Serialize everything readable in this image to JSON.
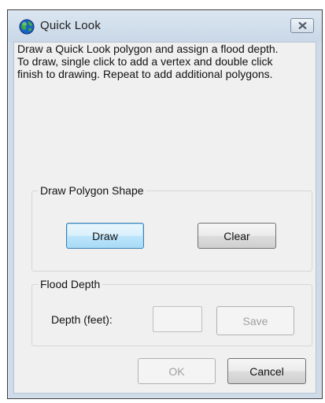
{
  "window": {
    "title": "Quick Look",
    "app_icon": "globe-icon",
    "close_icon": "close-icon"
  },
  "instructions": "Draw a Quick Look polygon and assign a flood depth. To draw, single click to add a vertex and double click finish to drawing. Repeat to add additional polygons.",
  "draw_group": {
    "label": "Draw Polygon Shape",
    "draw_label": "Draw",
    "clear_label": "Clear"
  },
  "flood_group": {
    "label": "Flood Depth",
    "depth_label": "Depth (feet):",
    "depth_value": "",
    "save_label": "Save"
  },
  "footer": {
    "ok_label": "OK",
    "cancel_label": "Cancel"
  },
  "colors": {
    "frame": "#cfdbe8",
    "client": "#f0f0f0",
    "focus_border": "#3c7fb1",
    "disabled_text": "#a0a0a0"
  }
}
